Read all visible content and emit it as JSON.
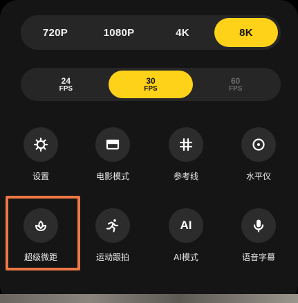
{
  "resolution": {
    "options": [
      "720P",
      "1080P",
      "4K",
      "8K"
    ],
    "selected": "8K"
  },
  "fps": {
    "options": [
      {
        "num": "24",
        "unit": "FPS",
        "state": "normal"
      },
      {
        "num": "30",
        "unit": "FPS",
        "state": "active"
      },
      {
        "num": "60",
        "unit": "FPS",
        "state": "disabled"
      }
    ]
  },
  "tools": [
    {
      "label": "设置",
      "icon": "gear-icon"
    },
    {
      "label": "电影模式",
      "icon": "cinema-icon"
    },
    {
      "label": "参考线",
      "icon": "grid-icon"
    },
    {
      "label": "水平仪",
      "icon": "level-icon"
    },
    {
      "label": "超级微距",
      "icon": "macro-flower-icon"
    },
    {
      "label": "运动跟拍",
      "icon": "running-person-icon"
    },
    {
      "label": "AI模式",
      "icon": "ai-icon",
      "icon_text": "AI"
    },
    {
      "label": "语音字幕",
      "icon": "microphone-icon"
    }
  ],
  "colors": {
    "accent": "#ffd21a",
    "highlight_box": "#ee7744",
    "panel": "#151515",
    "button_circle": "#2c2c2c"
  }
}
